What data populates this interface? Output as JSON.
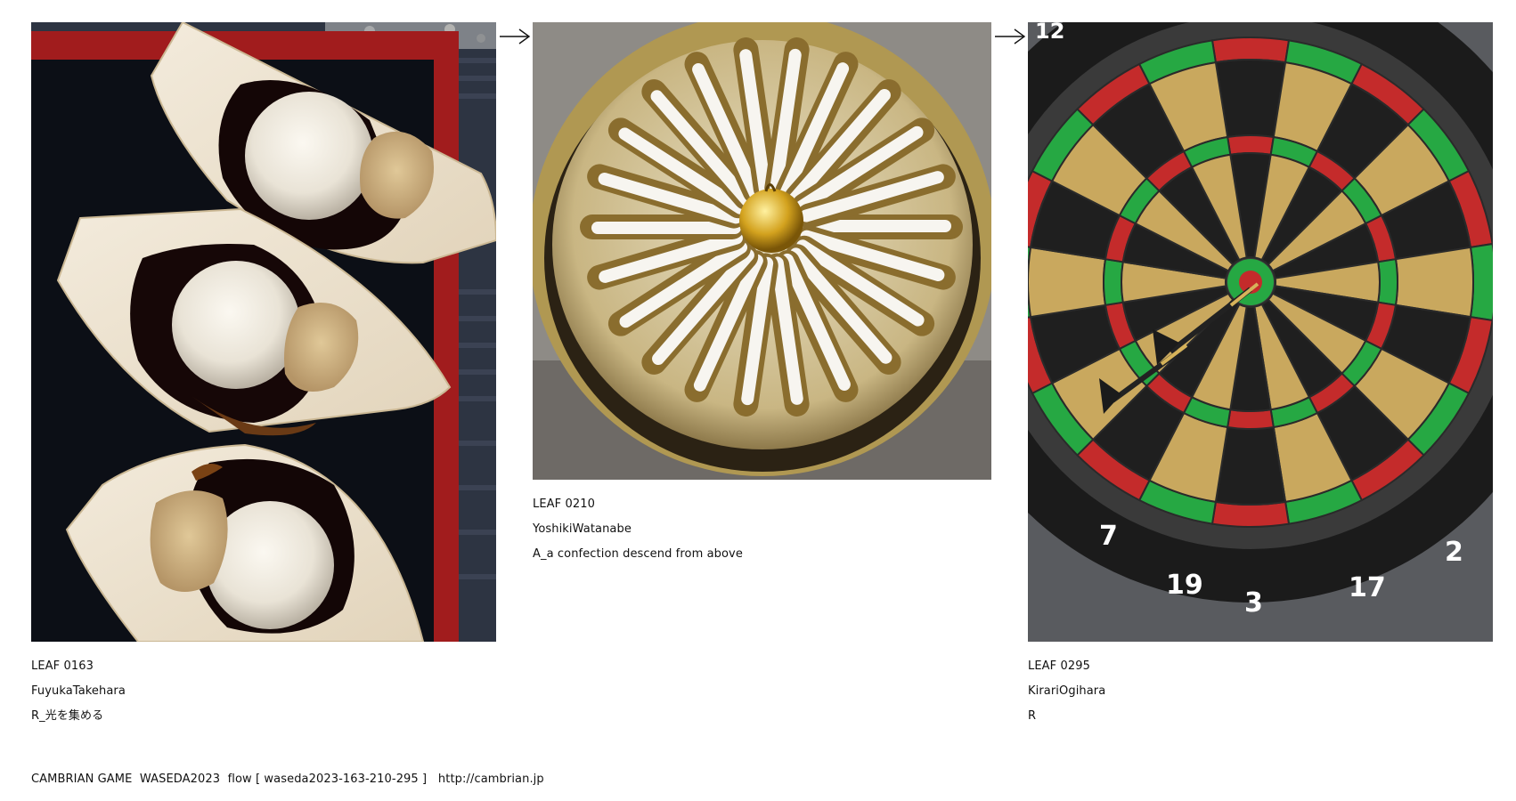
{
  "flow": [
    {
      "leaf_id": "LEAF 0163",
      "author": "FuyukaTakehara",
      "title": "R_光を集める",
      "image_label": "warabi-mochi-sweets-photo"
    },
    {
      "leaf_id": "LEAF 0210",
      "author": "YoshikiWatanabe",
      "title": "A_a confection descend from above",
      "image_label": "radial-confection-photo"
    },
    {
      "leaf_id": "LEAF 0295",
      "author": "KirariOgihara",
      "title": "R",
      "image_label": "dartboard-photo"
    }
  ],
  "dartboard_numbers": [
    "12",
    "7",
    "19",
    "3",
    "17",
    "2"
  ],
  "footer": {
    "brand": "CAMBRIAN GAME  WASEDA2023  flow [ waseda2023-163-210-295 ]",
    "url": "http://cambrian.jp"
  }
}
